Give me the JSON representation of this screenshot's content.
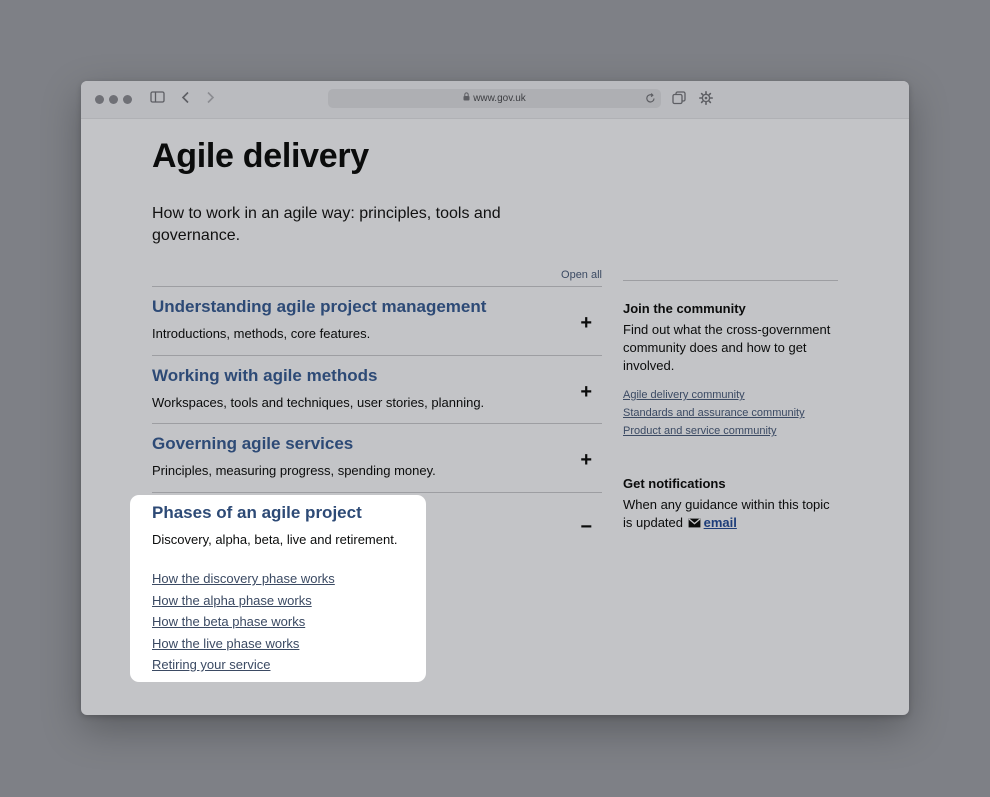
{
  "browser": {
    "url": "www.gov.uk",
    "icons": [
      "sidebar-icon",
      "back-icon",
      "forward-icon",
      "lock-icon",
      "reload-icon",
      "tabs-icon",
      "settings-icon"
    ]
  },
  "page": {
    "title": "Agile delivery",
    "lead": "How to work in an agile way: principles, tools and governance.",
    "open_all": "Open all",
    "sections": [
      {
        "title": "Understanding agile project management",
        "summary": "Introductions, methods, core features.",
        "icon": "+"
      },
      {
        "title": "Working with agile methods",
        "summary": "Workspaces, tools and techniques, user stories, planning.",
        "icon": "+"
      },
      {
        "title": "Governing agile services",
        "summary": "Principles, measuring progress, spending money.",
        "icon": "+"
      },
      {
        "title": "Phases of an agile project",
        "summary": "Discovery, alpha, beta, live and retirement.",
        "icon": "−",
        "links": [
          "How the discovery phase works",
          "How the alpha phase works",
          "How the beta phase works",
          "How the live phase works",
          "Retiring your service"
        ]
      }
    ]
  },
  "sidebar": {
    "community": {
      "heading": "Join the community",
      "text": "Find out what the cross-government community does and how to get involved.",
      "links": [
        "Agile delivery community",
        "Standards and assurance community",
        "Product and service community"
      ]
    },
    "notifications": {
      "heading": "Get notifications",
      "text": "When any guidance within this topic is updated",
      "email_label": "email"
    }
  },
  "colors": {
    "link": "#1d3d7a",
    "heading_link": "#2d4a76",
    "text": "#0b0c0c",
    "overlay": "#7e8086"
  }
}
